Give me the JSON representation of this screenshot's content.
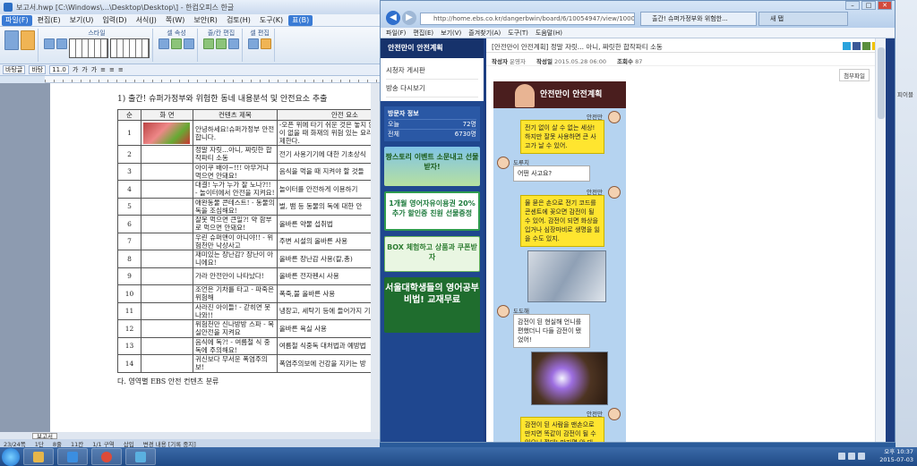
{
  "hwp": {
    "title": "보고서.hwp [C:\\Windows\\...\\Desktop\\Desktop\\] - 한컴오피스 한글",
    "menu": [
      "파일(F)",
      "편집(E)",
      "보기(U)",
      "입력(D)",
      "서식(J)",
      "쪽(W)",
      "보안(R)",
      "검토(H)",
      "도구(K)",
      "표(B)"
    ],
    "ribbon_groups": [
      "스타일",
      "셀 속성",
      "줄/칸 편집",
      "셀 편집"
    ],
    "font_style": "바탕글",
    "font_name": "바탕",
    "font_size": "11.0",
    "heading": "1) 출간! 슈퍼가정부와 위험한 동네 내용분석 및 안전요소 추출",
    "table_headers": [
      "순",
      "화 면",
      "컨텐츠 제목",
      "안전 요소"
    ],
    "rows": [
      {
        "num": "1",
        "has_image": true,
        "title": "안녕하세요!슈퍼가정부 안전합니다.",
        "safety": "-오픈 위에 타기 쉬운 것은 놓지 않는다. -어른이 없을 때 화재의 위험 있는 요리기구 사용 자제한다."
      },
      {
        "num": "2",
        "has_image": false,
        "title": "정말 자릿...아니, 짜릿한 합작파티 소동",
        "safety": "전기 사용기기에 대한 기초상식"
      },
      {
        "num": "3",
        "has_image": false,
        "title": "아이쿠 배야~!!! 아무거나 먹으면 안돼요!",
        "safety": "음식을 먹을 때 지켜야 할 것들"
      },
      {
        "num": "4",
        "has_image": false,
        "title": "대결! 누가 누가 잘 노나?!! - 놀이터에서 안전을 지켜요!",
        "safety": "놀이터를 안전하게 이용하기"
      },
      {
        "num": "5",
        "has_image": false,
        "title": "애완동물 콘테스트! - 동물의 독을 조심해요!",
        "safety": "벌, 뱀 등 동물의 독에 대한 안"
      },
      {
        "num": "6",
        "has_image": false,
        "title": "잘못 먹으면 큰일?! 약 함부로 먹으면 안돼요!",
        "safety": "올바른 약물 섭취법"
      },
      {
        "num": "7",
        "has_image": false,
        "title": "우린 슈퍼맨이 아니야!! - 위험천만 낙상사고",
        "safety": "주변 시설의 올바른 사용"
      },
      {
        "num": "8",
        "has_image": false,
        "title": "재미있는 장난감? 장난이 아니에요!",
        "safety": "올바른 장난감 사용(칼,총)"
      },
      {
        "num": "9",
        "has_image": false,
        "title": "가라 안전만이 나타났다!",
        "safety": "올바른 전자펜시 사용"
      },
      {
        "num": "10",
        "has_image": false,
        "title": "조언은 기차를 타고 - 파죽은 위험해",
        "safety": "폭죽,불 올바른 사용"
      },
      {
        "num": "11",
        "has_image": false,
        "title": "사라진 아이들! - 갇히면 못 나와!!",
        "safety": "냉장고, 세탁기 등에 들어가지 기"
      },
      {
        "num": "12",
        "has_image": false,
        "title": "위험천만 신나방방 스파 - 목실안전을 지켜요",
        "safety": "올바른 욕실 사용"
      },
      {
        "num": "13",
        "has_image": false,
        "title": "음식에 독?! - 여름철 식 중독에 주의해요!",
        "safety": "여름철 식중독 대처법과 예방법"
      },
      {
        "num": "14",
        "has_image": false,
        "title": "귀신보다 무서운 폭염주의 보!",
        "safety": "폭염주의보에 건강을 지키는 방"
      }
    ],
    "subheading": "다. 영역별 EBS 안전 컨텐츠 분류",
    "sheet_tab": "보고서",
    "status": [
      "23/24쪽",
      "1단",
      "8줄",
      "11칸",
      "1/1 구역",
      "삽입",
      "변경 내용 [기록 중지]"
    ]
  },
  "ie": {
    "address": "http://home.ebs.co.kr/dangerbwin/board/6/10054947/view/10000870",
    "tab_active": "출간! 슈퍼가정부와 위험한...",
    "tab_inactive": "새 탭",
    "menu": [
      "파일(F)",
      "편집(E)",
      "보기(V)",
      "즐겨찾기(A)",
      "도구(T)",
      "도움말(H)"
    ],
    "sidebar": {
      "header": "안전만이 안전계획",
      "links": [
        "시청자 게시판",
        "방송 다시보기"
      ],
      "visit_header": "방문자 정보",
      "visits": [
        {
          "label": "오늘",
          "value": "72명"
        },
        {
          "label": "전체",
          "value": "6730명"
        }
      ],
      "banners": [
        "짱스토리 이벤트 소문내고 선물받자!",
        "1개월 영어자유이용권 20% 추가 할인중 친원 선물증정",
        "BOX 체험하고 상품과 쿠폰받자",
        "서울대학생들의 영어공부비법! 교재무료"
      ]
    },
    "post": {
      "title": "[안전만이 안전계획] 정말 자릿... 아니, 짜릿한 합작파티 소동",
      "author_label": "작성자",
      "author": "운영자",
      "date_label": "작성일",
      "date": "2015.05.28 06:00",
      "views_label": "조회수",
      "views": "87",
      "tools_label": "첨부파일",
      "toon_header": "안전만이 안전계획",
      "messages": [
        {
          "speaker": "안전만",
          "side": "r",
          "text": "전기 없이 살 수 없는 세상! 하지만 잘못 사용하면 큰 사고가 날 수 있어."
        },
        {
          "speaker": "도루치",
          "side": "l",
          "text": "어떤 사고요?"
        },
        {
          "speaker": "안전만",
          "side": "r",
          "text": "물 묻은 손으로 전기 코드를 콘센트에 꽂으면 감전이 될 수 있어. 감전이 되면 화상을 입거나 심장마비로 생명을 잃을 수도 있지."
        },
        {
          "speaker": "도도해",
          "side": "l",
          "text": "감전이 된 현실해 언니를 편했더니 다들 감전이 됐었어!"
        },
        {
          "speaker": "안전만",
          "side": "r",
          "text": "감전이 된 사람을 맨손으로 만지면 똑같이 감전이 될 수 있으니 절대! 만지면 안 돼."
        }
      ]
    }
  },
  "taskbar": {
    "time": "오후 10:37",
    "date": "2015-07-03"
  },
  "desktop": {
    "label": "피이블"
  }
}
